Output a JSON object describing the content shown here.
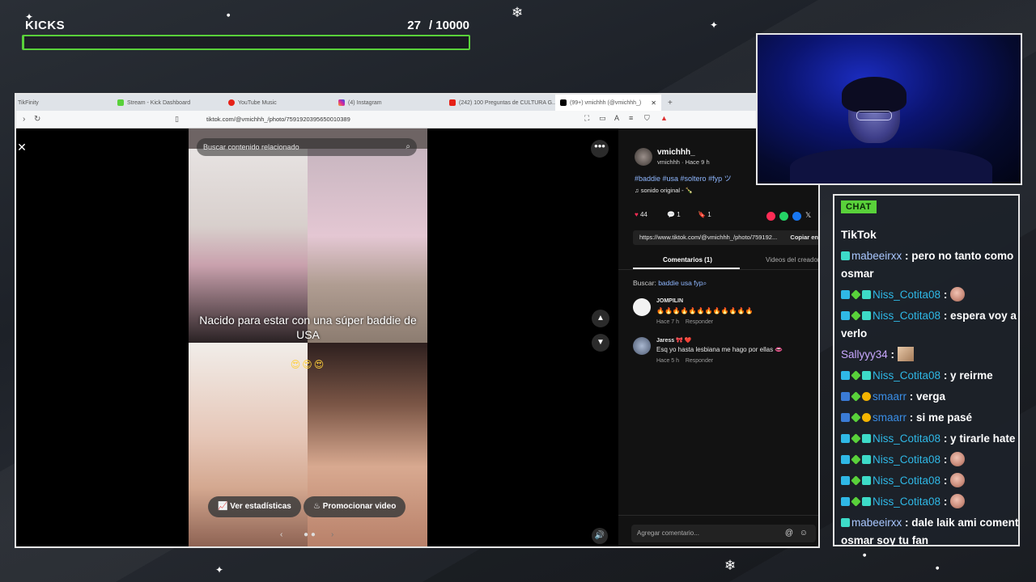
{
  "kicks": {
    "title": "KICKS",
    "current": "27",
    "goal": "/ 10000",
    "progress_fraction": 0.0027,
    "bar_color": "#59d13a"
  },
  "browser": {
    "tabs": [
      {
        "label": "TikFinity",
        "active": false
      },
      {
        "label": "Stream - Kick Dashboard",
        "active": false
      },
      {
        "label": "YouTube Music",
        "active": false
      },
      {
        "label": "(4) Instagram",
        "active": false
      },
      {
        "label": "(242) 100 Preguntas de CULTURA G...",
        "active": false
      },
      {
        "label": "(99+) vmichhh (@vmichhh_)",
        "active": true
      }
    ],
    "new_tab": "+",
    "url": "tiktok.com/@vmichhh_/photo/7591920395650010389"
  },
  "viewer": {
    "search_placeholder": "Buscar contenido relacionado",
    "caption": "Nacido para estar con una súper baddie de USA",
    "caption_emojis": "😍😍😍",
    "stats_button": "Ver estadísticas",
    "promote_button": "Promocionar video"
  },
  "post": {
    "username": "vmichhh_",
    "subline": "vmichhh · Hace 9 h",
    "hashtags": "#baddie #usa #soltero #fyp ツ",
    "sound": "sonido original - 🍾",
    "likes": "44",
    "comments": "1",
    "saves": "1",
    "link": "https://www.tiktok.com/@vmichhh_/photo/759192...",
    "copy_label": "Copiar en",
    "tab_comments": "Comentarios (1)",
    "tab_creator": "Videos del creador",
    "search_prefix": "Buscar:",
    "search_term": "baddie usa fyp",
    "comment_input_placeholder": "Agregar comentario...",
    "comments_list": [
      {
        "user": "JOMPILIN",
        "text": "🔥🔥🔥🔥🔥🔥🔥🔥🔥🔥🔥🔥",
        "time": "Hace 7 h",
        "reply": "Responder"
      },
      {
        "user": "Jaress 🎀 ❤️",
        "text": "Esq yo hasta lesbiana me hago por ellas 👄",
        "time": "Hace 5 h",
        "reply": "Responder"
      }
    ]
  },
  "chat": {
    "header": "CHAT",
    "source": "TikTok",
    "messages": [
      {
        "badges": [
          "grid"
        ],
        "user": "mabeeirxx",
        "user_color": "#a9c7ff",
        "text": ": pero no tanto como osmar"
      },
      {
        "badges": [
          "sub",
          "gift",
          "grid"
        ],
        "user": "Niss_Cotita08",
        "user_color": "#2fb8e6",
        "text": ":",
        "emote": "face"
      },
      {
        "badges": [
          "sub",
          "gift",
          "grid"
        ],
        "user": "Niss_Cotita08",
        "user_color": "#2fb8e6",
        "text": ": espera voy a verlo"
      },
      {
        "badges": [],
        "user": "Sallyyy34",
        "user_color": "#c9a8ff",
        "text": ":",
        "emote": "square"
      },
      {
        "badges": [
          "sub",
          "gift",
          "grid"
        ],
        "user": "Niss_Cotita08",
        "user_color": "#2fb8e6",
        "text": ": y reirme"
      },
      {
        "badges": [
          "mod",
          "gift",
          "gold"
        ],
        "user": "smaarr",
        "user_color": "#3a8ee6",
        "text": ": verga"
      },
      {
        "badges": [
          "mod",
          "gift",
          "gold"
        ],
        "user": "smaarr",
        "user_color": "#3a8ee6",
        "text": ": si me pasé"
      },
      {
        "badges": [
          "sub",
          "gift",
          "grid"
        ],
        "user": "Niss_Cotita08",
        "user_color": "#2fb8e6",
        "text": ": y tirarle hate"
      },
      {
        "badges": [
          "sub",
          "gift",
          "grid"
        ],
        "user": "Niss_Cotita08",
        "user_color": "#2fb8e6",
        "text": ":",
        "emote": "face"
      },
      {
        "badges": [
          "sub",
          "gift",
          "grid"
        ],
        "user": "Niss_Cotita08",
        "user_color": "#2fb8e6",
        "text": ":",
        "emote": "face"
      },
      {
        "badges": [
          "sub",
          "gift",
          "grid"
        ],
        "user": "Niss_Cotita08",
        "user_color": "#2fb8e6",
        "text": ":",
        "emote": "face"
      },
      {
        "badges": [
          "grid"
        ],
        "user": "mabeeirxx",
        "user_color": "#a9c7ff",
        "text": ": dale laik ami comentario osmar soy tu fan"
      }
    ]
  }
}
